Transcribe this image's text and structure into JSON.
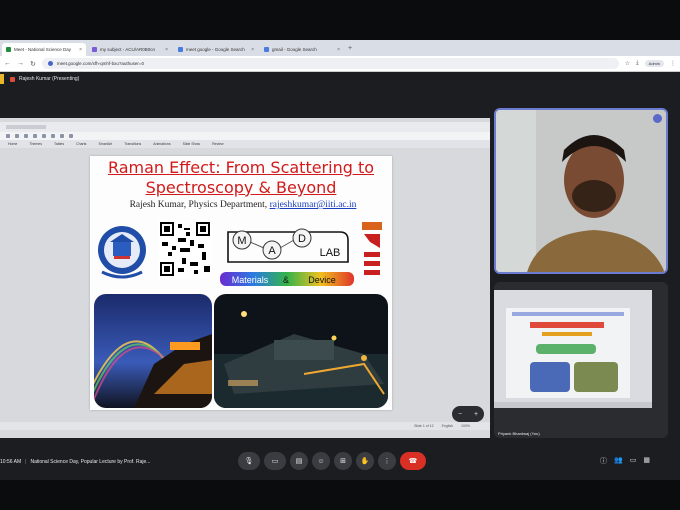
{
  "browser": {
    "tabs": [
      {
        "label": "Meet - National Science Day",
        "active": true,
        "color": "#1f8e3d"
      },
      {
        "label": "my subject - ACU/AR0B0cn",
        "active": false,
        "color": "#7b5cd6"
      },
      {
        "label": "meet google - Google Search",
        "active": false,
        "color": "#4a7be0"
      },
      {
        "label": "gmail - Google Search",
        "active": false,
        "color": "#4a7be0"
      }
    ],
    "new_tab": "+",
    "url": "meet.google.com/xfh-qmhf-bxu?authuser=0",
    "profile": "Admin"
  },
  "meet": {
    "presenter_label": "Rajesh Kumar (Presenting)",
    "clock": "10:56 AM",
    "meeting_title": "National Science Day, Popular Lecture by Prof. Raje...",
    "screen_tile_label": "Priyank Bhardwaj (You)"
  },
  "app": {
    "menus": [
      "Home",
      "Themes",
      "Tables",
      "Charts",
      "SmartArt",
      "Transitions",
      "Animations",
      "Slide Show",
      "Review"
    ],
    "status": [
      "Slide 1 of 12",
      "English",
      "100%"
    ]
  },
  "slide": {
    "title_line1": "Raman Effect: From Scattering to",
    "title_line2": "Spectroscopy & Beyond",
    "author": "Rajesh Kumar, Physics Department, ",
    "email": "rajeshkumar@iiti.ac.in",
    "lab_letters": [
      "M",
      "A",
      "D",
      "LAB"
    ],
    "lab_words": [
      "Materials",
      "&",
      "Device"
    ],
    "title_color": "#d21a1a"
  },
  "icons": {
    "mic": "mic-icon",
    "camera": "camera-icon",
    "captions": "captions-icon",
    "emoji": "emoji-icon",
    "present": "present-icon",
    "hand": "raise-hand-icon",
    "more": "more-icon",
    "end": "end-call-icon"
  }
}
